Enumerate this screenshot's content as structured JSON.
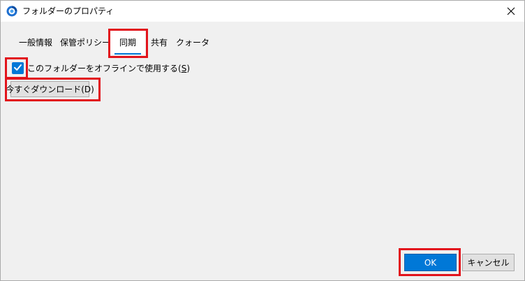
{
  "window": {
    "title": "フォルダーのプロパティ"
  },
  "tabs": [
    {
      "label": "一般情報",
      "selected": false
    },
    {
      "label": "保管ポリシー",
      "selected": false
    },
    {
      "label": "同期",
      "selected": true
    },
    {
      "label": "共有",
      "selected": false
    },
    {
      "label": "クォータ",
      "selected": false
    }
  ],
  "sync": {
    "offline_checkbox": {
      "label": "このフォルダーをオフラインで使用する(",
      "access_key": "S",
      "label_end": ")",
      "checked": true
    },
    "download_button_label": "今すぐダウンロード(D)"
  },
  "footer": {
    "ok_label": "OK",
    "cancel_label": "キャンセル"
  },
  "colors": {
    "accent": "#0078d7",
    "highlight": "#e2141c",
    "panel": "#f0f0f0"
  },
  "icons": {
    "app": "app-icon",
    "close": "close-icon",
    "check": "check-icon"
  }
}
